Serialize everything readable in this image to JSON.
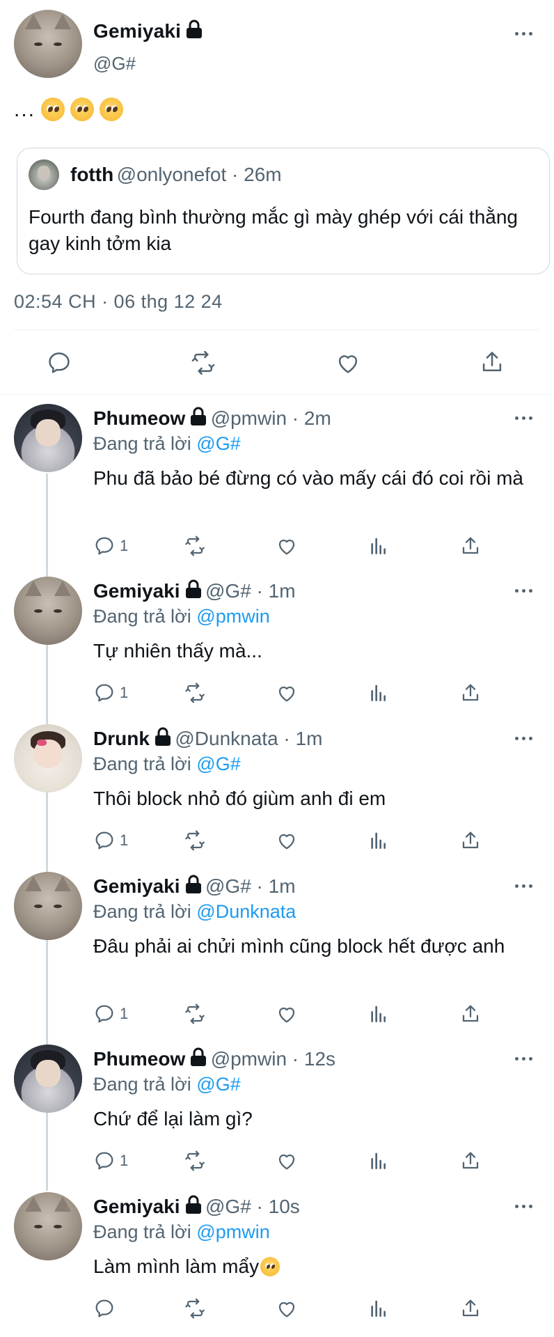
{
  "main_tweet": {
    "author_name": "Gemiyaki",
    "author_handle": "@G#",
    "text": "...",
    "emoji_count": 3,
    "quoted": {
      "name": "fotth",
      "meta": "@onlyonefot · 26m",
      "text": "Fourth đang bình thường mắc gì mày ghép với cái thằng gay kinh tởm kia"
    },
    "timestamp": "02:54 CH · 06 thg 12 24",
    "actions": [
      "reply-icon",
      "retweet-icon",
      "like-icon",
      "share-icon"
    ]
  },
  "replies": [
    {
      "name": "Phumeow",
      "meta": "@pmwin · 2m",
      "replying_prefix": "Đang trả lời",
      "replying_to": "@G#",
      "text": "Phu đã bảo bé đừng có vào mấy cái đó coi rồi mà",
      "reply_count": "1",
      "avatar": "person"
    },
    {
      "name": "Gemiyaki",
      "meta": "@G# · 1m",
      "replying_prefix": "Đang trả lời",
      "replying_to": "@pmwin",
      "text": "Tự nhiên thấy mà...",
      "reply_count": "1",
      "avatar": "cat"
    },
    {
      "name": "Drunk",
      "meta": "@Dunknata · 1m",
      "replying_prefix": "Đang trả lời",
      "replying_to": "@G#",
      "text": "Thôi block nhỏ đó giùm anh đi em",
      "reply_count": "1",
      "avatar": "drunk"
    },
    {
      "name": "Gemiyaki",
      "meta": "@G# · 1m",
      "replying_prefix": "Đang trả lời",
      "replying_to": "@Dunknata",
      "text": "Đâu phải ai chửi mình cũng block hết được anh",
      "reply_count": "1",
      "avatar": "cat"
    },
    {
      "name": "Phumeow",
      "meta": "@pmwin · 12s",
      "replying_prefix": "Đang trả lời",
      "replying_to": "@G#",
      "text": "Chứ để lại làm gì?",
      "reply_count": "1",
      "avatar": "person"
    },
    {
      "name": "Gemiyaki",
      "meta": "@G# · 10s",
      "replying_prefix": "Đang trả lời",
      "replying_to": "@pmwin",
      "text": "Làm mình làm mẩy",
      "reply_count": "",
      "avatar": "cat"
    }
  ],
  "colors": {
    "link": "#1d9bf0",
    "secondary": "#536471",
    "border": "#cfd9de"
  }
}
